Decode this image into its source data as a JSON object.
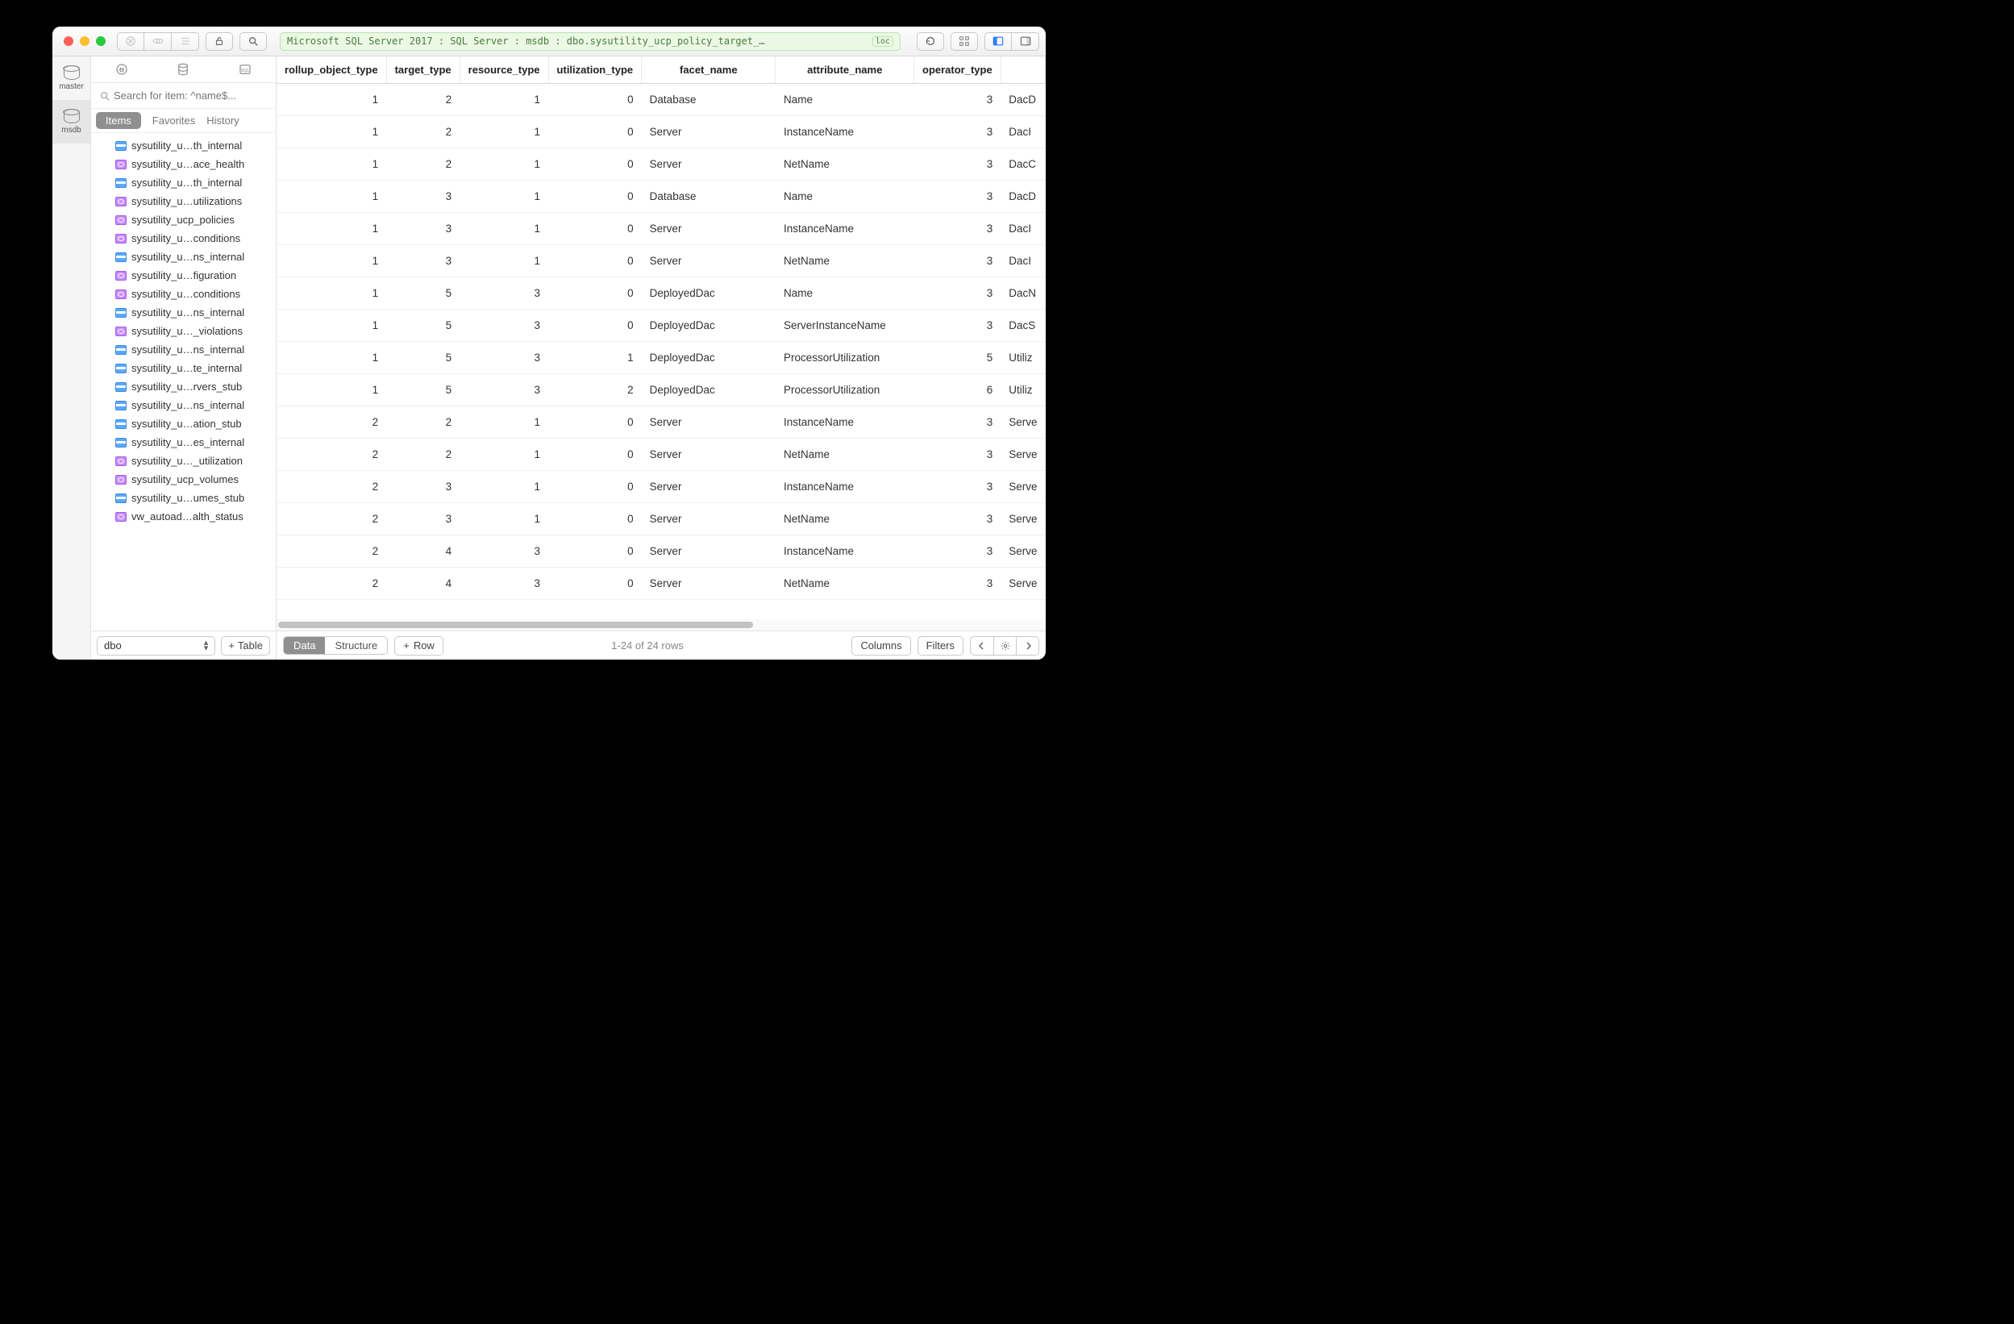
{
  "titlebar": {
    "breadcrumb": "Microsoft SQL Server 2017 : SQL Server : msdb : dbo.sysutility_ucp_policy_target_…",
    "badge": "loc"
  },
  "rail": [
    {
      "label": "master",
      "selected": false
    },
    {
      "label": "msdb",
      "selected": true
    }
  ],
  "sidebar": {
    "search_placeholder": "Search for item: ^name$...",
    "tabs": {
      "items": "Items",
      "favorites": "Favorites",
      "history": "History"
    },
    "tree": [
      {
        "kind": "table",
        "label": "sysutility_u…th_internal"
      },
      {
        "kind": "view",
        "label": "sysutility_u…ace_health"
      },
      {
        "kind": "table",
        "label": "sysutility_u…th_internal"
      },
      {
        "kind": "view",
        "label": "sysutility_u…utilizations"
      },
      {
        "kind": "view",
        "label": "sysutility_ucp_policies"
      },
      {
        "kind": "view",
        "label": "sysutility_u…conditions"
      },
      {
        "kind": "table",
        "label": "sysutility_u…ns_internal"
      },
      {
        "kind": "view",
        "label": "sysutility_u…figuration"
      },
      {
        "kind": "view",
        "label": "sysutility_u…conditions"
      },
      {
        "kind": "table",
        "label": "sysutility_u…ns_internal"
      },
      {
        "kind": "view",
        "label": "sysutility_u…_violations"
      },
      {
        "kind": "table",
        "label": "sysutility_u…ns_internal"
      },
      {
        "kind": "table",
        "label": "sysutility_u…te_internal"
      },
      {
        "kind": "table",
        "label": "sysutility_u…rvers_stub"
      },
      {
        "kind": "table",
        "label": "sysutility_u…ns_internal"
      },
      {
        "kind": "table",
        "label": "sysutility_u…ation_stub"
      },
      {
        "kind": "table",
        "label": "sysutility_u…es_internal"
      },
      {
        "kind": "view",
        "label": "sysutility_u…_utilization"
      },
      {
        "kind": "view",
        "label": "sysutility_ucp_volumes"
      },
      {
        "kind": "table",
        "label": "sysutility_u…umes_stub"
      },
      {
        "kind": "view",
        "label": "vw_autoad…alth_status"
      }
    ],
    "schema": "dbo",
    "add_table": "Table"
  },
  "table": {
    "columns": [
      {
        "key": "rollup_object_type",
        "label": "rollup_object_type",
        "w": 125,
        "align": "num"
      },
      {
        "key": "target_type",
        "label": "target_type",
        "w": 91,
        "align": "num"
      },
      {
        "key": "resource_type",
        "label": "resource_type",
        "w": 103,
        "align": "num"
      },
      {
        "key": "utilization_type",
        "label": "utilization_type",
        "w": 108,
        "align": "num"
      },
      {
        "key": "facet_name",
        "label": "facet_name",
        "w": 178,
        "align": "txt"
      },
      {
        "key": "attribute_name",
        "label": "attribute_name",
        "w": 176,
        "align": "txt"
      },
      {
        "key": "operator_type",
        "label": "operator_type",
        "w": 97,
        "align": "num"
      },
      {
        "key": "extra",
        "label": "",
        "w": 50,
        "align": "txt"
      }
    ],
    "rows": [
      {
        "rollup_object_type": "1",
        "target_type": "2",
        "resource_type": "1",
        "utilization_type": "0",
        "facet_name": "Database",
        "attribute_name": "Name",
        "operator_type": "3",
        "extra": "DacD"
      },
      {
        "rollup_object_type": "1",
        "target_type": "2",
        "resource_type": "1",
        "utilization_type": "0",
        "facet_name": "Server",
        "attribute_name": "InstanceName",
        "operator_type": "3",
        "extra": "DacI"
      },
      {
        "rollup_object_type": "1",
        "target_type": "2",
        "resource_type": "1",
        "utilization_type": "0",
        "facet_name": "Server",
        "attribute_name": "NetName",
        "operator_type": "3",
        "extra": "DacC"
      },
      {
        "rollup_object_type": "1",
        "target_type": "3",
        "resource_type": "1",
        "utilization_type": "0",
        "facet_name": "Database",
        "attribute_name": "Name",
        "operator_type": "3",
        "extra": "DacD"
      },
      {
        "rollup_object_type": "1",
        "target_type": "3",
        "resource_type": "1",
        "utilization_type": "0",
        "facet_name": "Server",
        "attribute_name": "InstanceName",
        "operator_type": "3",
        "extra": "DacI"
      },
      {
        "rollup_object_type": "1",
        "target_type": "3",
        "resource_type": "1",
        "utilization_type": "0",
        "facet_name": "Server",
        "attribute_name": "NetName",
        "operator_type": "3",
        "extra": "DacI"
      },
      {
        "rollup_object_type": "1",
        "target_type": "5",
        "resource_type": "3",
        "utilization_type": "0",
        "facet_name": "DeployedDac",
        "attribute_name": "Name",
        "operator_type": "3",
        "extra": "DacN"
      },
      {
        "rollup_object_type": "1",
        "target_type": "5",
        "resource_type": "3",
        "utilization_type": "0",
        "facet_name": "DeployedDac",
        "attribute_name": "ServerInstanceName",
        "operator_type": "3",
        "extra": "DacS"
      },
      {
        "rollup_object_type": "1",
        "target_type": "5",
        "resource_type": "3",
        "utilization_type": "1",
        "facet_name": "DeployedDac",
        "attribute_name": "ProcessorUtilization",
        "operator_type": "5",
        "extra": "Utiliz"
      },
      {
        "rollup_object_type": "1",
        "target_type": "5",
        "resource_type": "3",
        "utilization_type": "2",
        "facet_name": "DeployedDac",
        "attribute_name": "ProcessorUtilization",
        "operator_type": "6",
        "extra": "Utiliz"
      },
      {
        "rollup_object_type": "2",
        "target_type": "2",
        "resource_type": "1",
        "utilization_type": "0",
        "facet_name": "Server",
        "attribute_name": "InstanceName",
        "operator_type": "3",
        "extra": "Serve"
      },
      {
        "rollup_object_type": "2",
        "target_type": "2",
        "resource_type": "1",
        "utilization_type": "0",
        "facet_name": "Server",
        "attribute_name": "NetName",
        "operator_type": "3",
        "extra": "Serve"
      },
      {
        "rollup_object_type": "2",
        "target_type": "3",
        "resource_type": "1",
        "utilization_type": "0",
        "facet_name": "Server",
        "attribute_name": "InstanceName",
        "operator_type": "3",
        "extra": "Serve"
      },
      {
        "rollup_object_type": "2",
        "target_type": "3",
        "resource_type": "1",
        "utilization_type": "0",
        "facet_name": "Server",
        "attribute_name": "NetName",
        "operator_type": "3",
        "extra": "Serve"
      },
      {
        "rollup_object_type": "2",
        "target_type": "4",
        "resource_type": "3",
        "utilization_type": "0",
        "facet_name": "Server",
        "attribute_name": "InstanceName",
        "operator_type": "3",
        "extra": "Serve"
      },
      {
        "rollup_object_type": "2",
        "target_type": "4",
        "resource_type": "3",
        "utilization_type": "0",
        "facet_name": "Server",
        "attribute_name": "NetName",
        "operator_type": "3",
        "extra": "Serve"
      }
    ]
  },
  "bottom": {
    "tabs": {
      "data": "Data",
      "structure": "Structure"
    },
    "add_row": "Row",
    "status": "1-24 of 24 rows",
    "columns_btn": "Columns",
    "filters_btn": "Filters"
  }
}
